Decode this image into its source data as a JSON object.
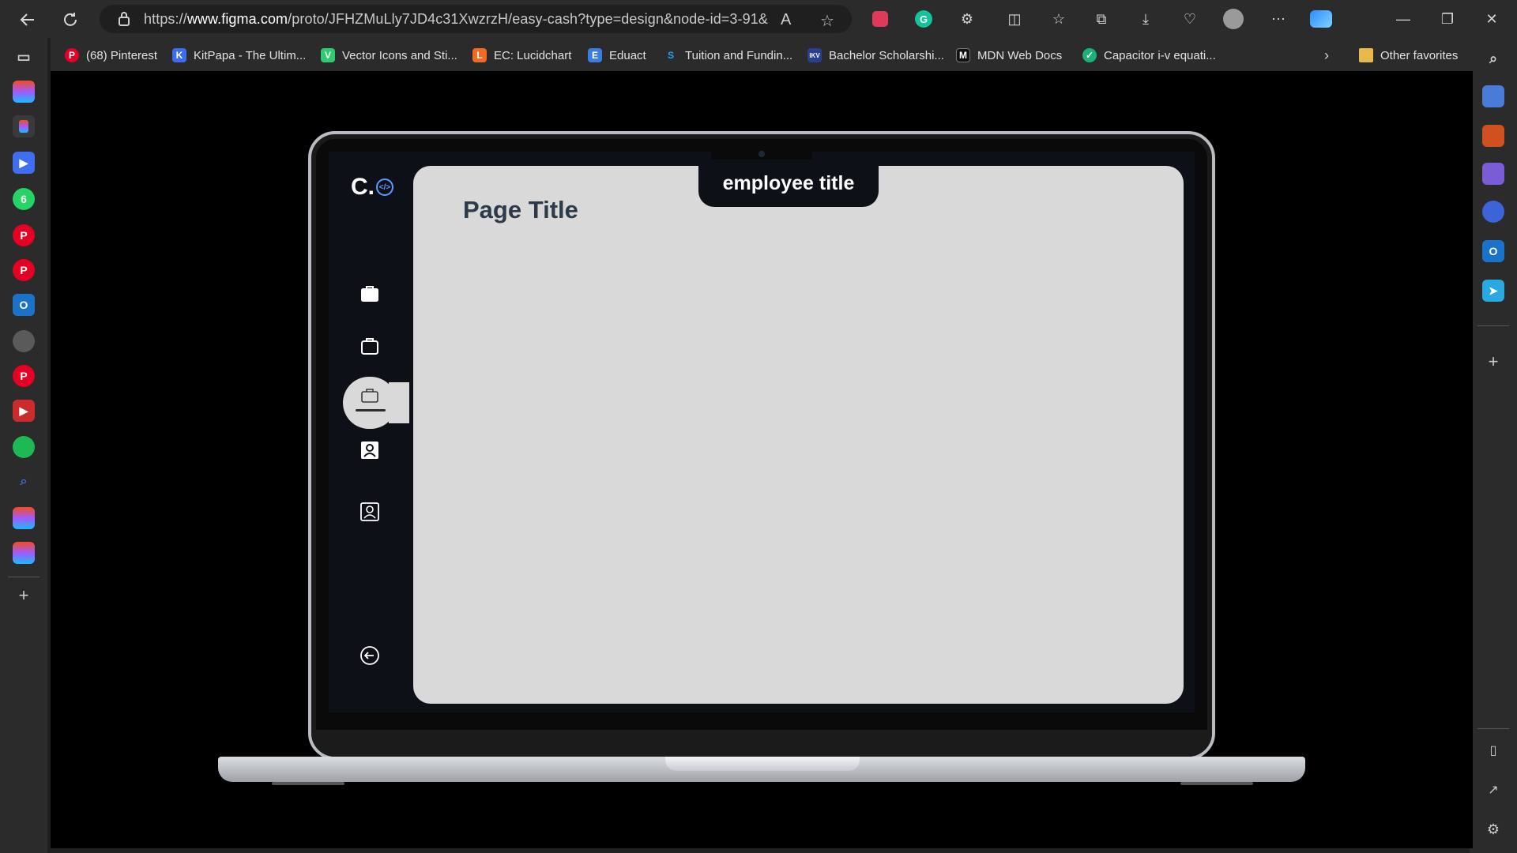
{
  "browser": {
    "url_prefix": "https://",
    "url_host": "www.figma.com",
    "url_path": "/proto/JFHZMuLly7JD4c31XwzrzH/easy-cash?type=design&node-id=3-91&t...",
    "favorites": [
      {
        "label": "(68) Pinterest",
        "icon": "pinterest-icon",
        "color": "#e60023"
      },
      {
        "label": "KitPapa - The Ultim...",
        "icon": "kitpapa-icon",
        "color": "#3a6df0"
      },
      {
        "label": "Vector Icons and Sti...",
        "icon": "vector-icons-icon",
        "color": "#2ecc71"
      },
      {
        "label": "EC: Lucidchart",
        "icon": "lucidchart-icon",
        "color": "#f26b21"
      },
      {
        "label": "Eduact",
        "icon": "eduact-icon",
        "color": "#3c7ce0"
      },
      {
        "label": "Tuition and Fundin...",
        "icon": "s-icon",
        "color": "#1ba3f2"
      },
      {
        "label": "Bachelor Scholarshi...",
        "icon": "ikv-icon",
        "color": "#2b3f8f"
      },
      {
        "label": "MDN Web Docs",
        "icon": "mdn-icon",
        "color": "#111111"
      },
      {
        "label": "Capacitor i-v equati...",
        "icon": "capacitor-icon",
        "color": "#19b37a"
      }
    ],
    "other_favorites": "Other favorites"
  },
  "app": {
    "page_title": "Page Title",
    "employee_title": "employee title",
    "sidebar_icons": [
      "briefcase-filled-icon",
      "briefcase-outline-icon",
      "briefcase-active-icon",
      "user-card-filled-icon",
      "user-card-outline-icon",
      "logout-icon"
    ],
    "logo_letter": "C.",
    "logo_code": "</>"
  }
}
